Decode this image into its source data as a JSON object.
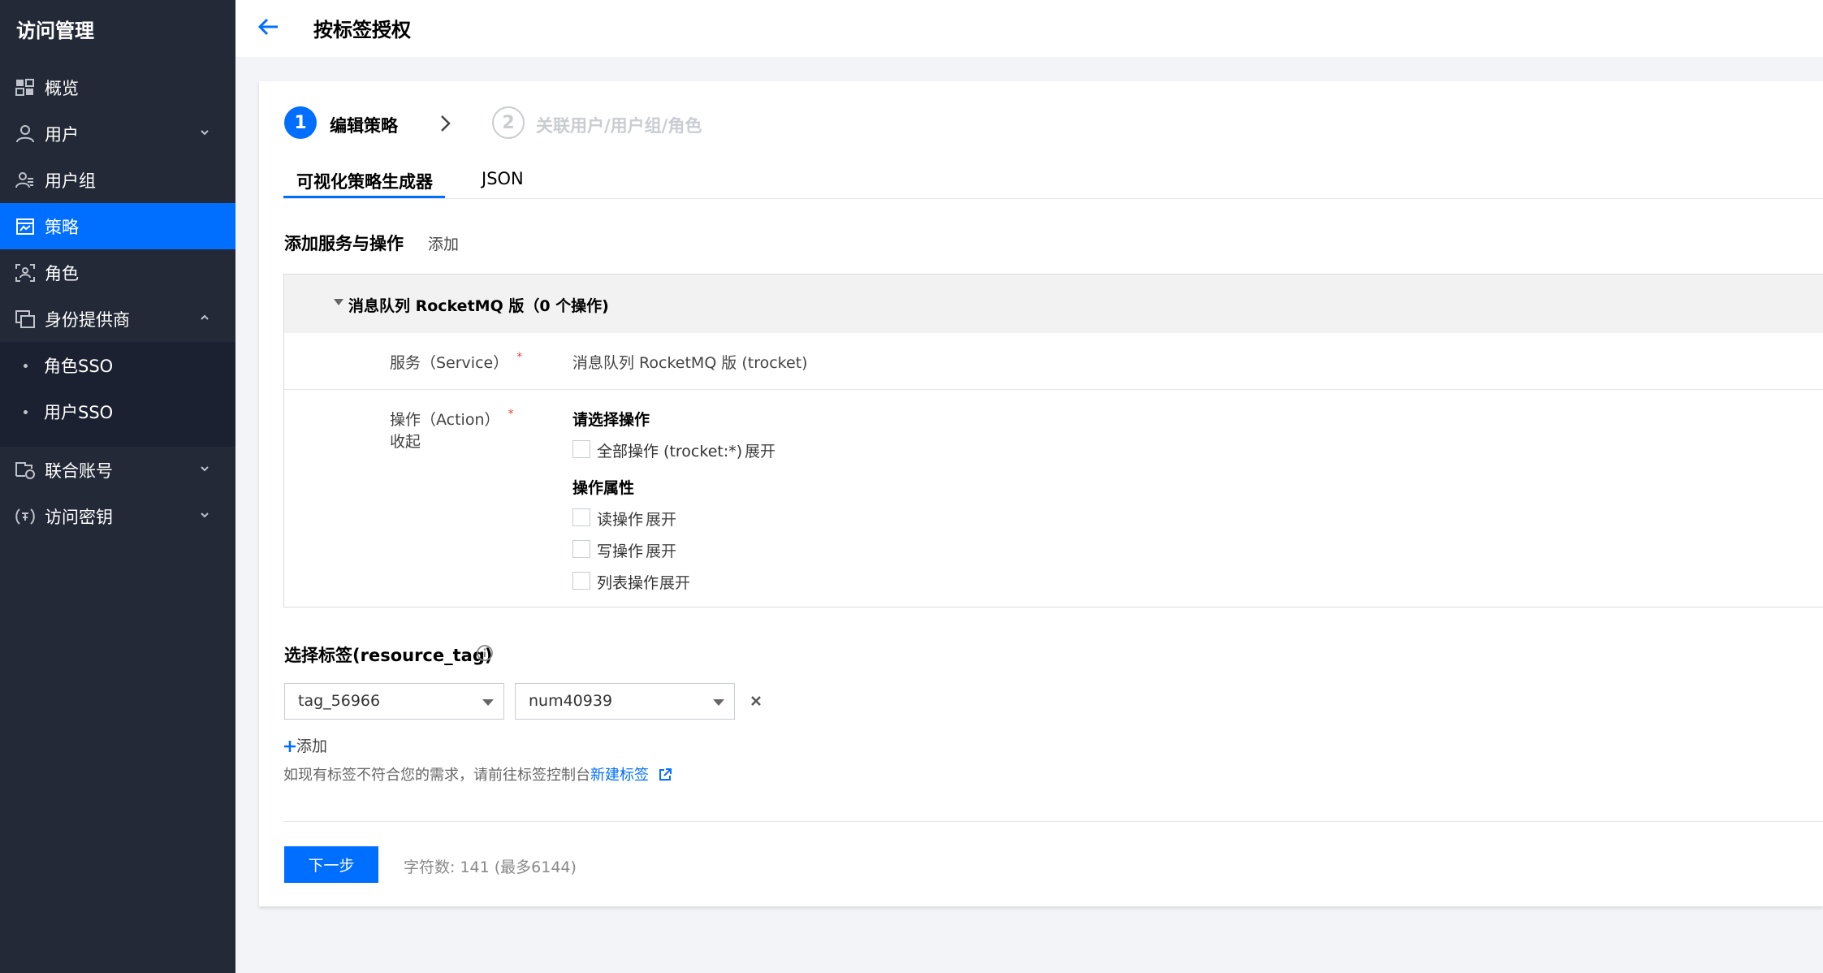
{
  "sidebar": {
    "title": "访问管理",
    "items": [
      {
        "label": "概览"
      },
      {
        "label": "用户"
      },
      {
        "label": "用户组"
      },
      {
        "label": "策略"
      },
      {
        "label": "角色"
      },
      {
        "label": "身份提供商"
      },
      {
        "label": "联合账号"
      },
      {
        "label": "访问密钥"
      }
    ],
    "sub_items": [
      {
        "label": "角色SSO"
      },
      {
        "label": "用户SSO"
      }
    ]
  },
  "header": {
    "title": "按标签授权"
  },
  "steps": [
    {
      "number": "1",
      "label": "编辑策略"
    },
    {
      "number": "2",
      "label": "关联用户/用户组/角色"
    }
  ],
  "tabs": [
    {
      "label": "可视化策略生成器"
    },
    {
      "label": "JSON"
    }
  ],
  "services_section": {
    "title": "添加服务与操作",
    "add_link": "添加",
    "panel_title": "消息队列 RocketMQ 版（0 个操作)",
    "service_label": "服务（Service）",
    "service_value": "消息队列 RocketMQ 版 (trocket)",
    "action_label": "操作（Action）",
    "collapse_link": "收起",
    "required_mark": "*",
    "choose_title": "请选择操作",
    "all_actions_label": "全部操作 (trocket:*)",
    "expand_link": "展开",
    "attr_title": "操作属性",
    "attrs": [
      {
        "label": "读操作",
        "link": "展开"
      },
      {
        "label": "写操作",
        "link": "展开"
      },
      {
        "label": "列表操作",
        "link": "展开"
      }
    ]
  },
  "tag_section": {
    "title": "选择标签(resource_tag)",
    "tag_key": "tag_56966",
    "tag_value": "num40939",
    "add_label": "添加",
    "hint_text": "如现有标签不符合您的需求，请前往标签控制台",
    "hint_link": "新建标签"
  },
  "footer": {
    "next_button": "下一步",
    "char_count": "字符数: 141 (最多6144)"
  },
  "colors": {
    "accent": "#006eff",
    "sidebar_bg": "#232936",
    "required": "#e54545"
  }
}
